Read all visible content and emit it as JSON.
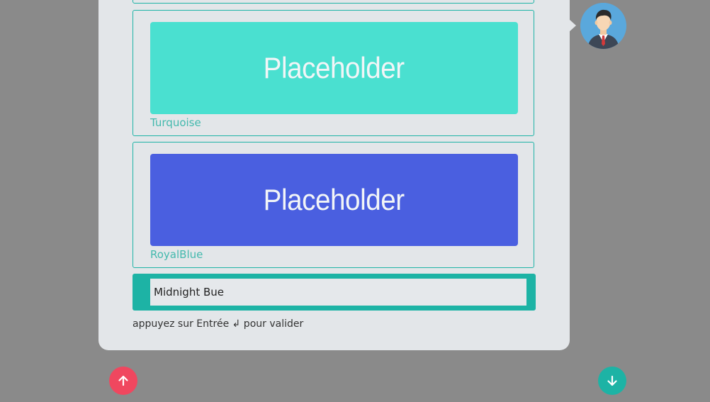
{
  "options": [
    {
      "placeholder_text": "Placeholder",
      "label": "Turquoise",
      "color": "#4ae0d0"
    },
    {
      "placeholder_text": "Placeholder",
      "label": "RoyalBlue",
      "color": "#4a5fe0"
    }
  ],
  "input": {
    "value": "Midnight Bue"
  },
  "hint": "appuyez sur Entrée ↲ pour valider",
  "colors": {
    "accent": "#1db3a5",
    "up_button": "#f0475f",
    "card_background": "#e3e6e9",
    "page_background": "#8a8a8a"
  },
  "icons": {
    "avatar": "businessman-avatar-icon",
    "up": "arrow-up-icon",
    "down": "arrow-down-icon"
  }
}
